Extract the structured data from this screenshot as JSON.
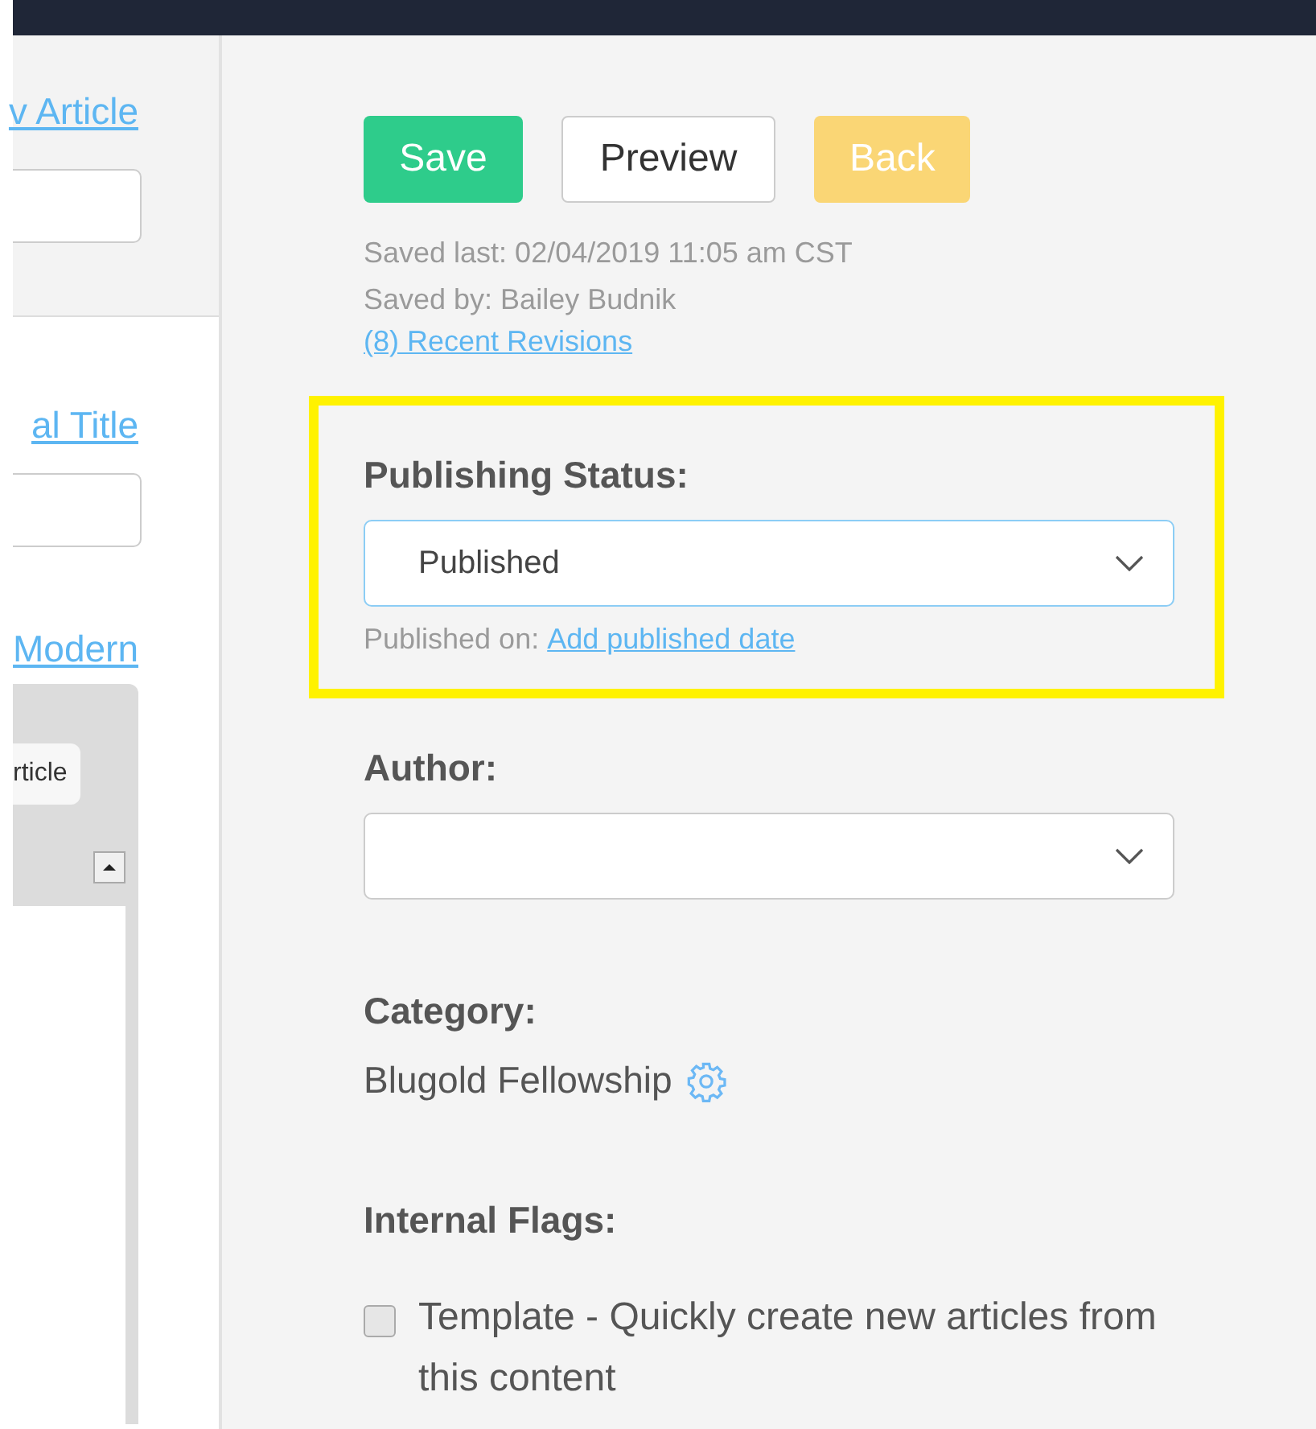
{
  "sidebar": {
    "links": [
      {
        "text": "v Article",
        "field": true
      },
      {
        "text": "al Title",
        "field": true
      },
      {
        "text": "Modern",
        "field": false
      }
    ],
    "editor": {
      "button": "rticle"
    }
  },
  "actions": [
    {
      "label": "Save",
      "kind": "primary"
    },
    {
      "label": "Preview",
      "kind": "default"
    },
    {
      "label": "Back",
      "kind": "warning"
    }
  ],
  "saved_last": "Saved last: 02/04/2019 11:05 am CST",
  "saved_by": "Saved by: Bailey Budnik",
  "revisions_link": "(8) Recent Revisions",
  "publishing": {
    "label": "Publishing Status:",
    "value": "Published",
    "highlighted": true,
    "published_on": "Published on:",
    "date_link": "Add published date"
  },
  "author": {
    "label": "Author:"
  },
  "category": {
    "label": "Category:",
    "value": "Blugold Fellowship"
  },
  "flags": {
    "label": "Internal Flags:",
    "items": [
      {
        "text": "Template - Quickly create new articles from this content",
        "checked": false
      }
    ]
  }
}
